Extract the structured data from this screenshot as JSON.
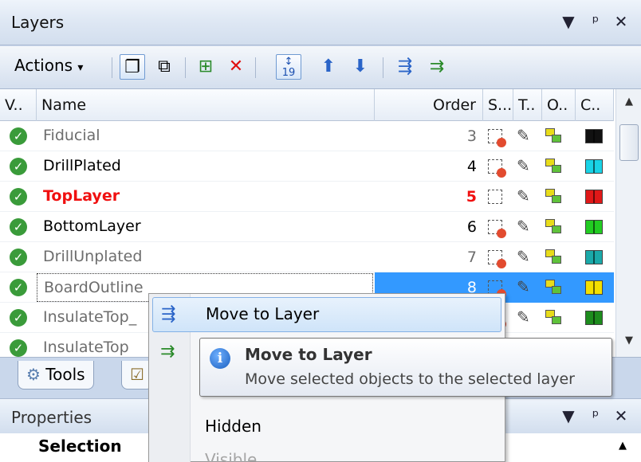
{
  "layers_panel": {
    "title": "Layers",
    "title_buttons": [
      "▾",
      "ᵖ",
      "✕"
    ],
    "actions_label": "Actions",
    "actions_arrow": "▾",
    "toolbar_icons": [
      "copy-layer-icon",
      "paste-layer-icon",
      "add-layer-icon",
      "delete-icon",
      "sort-order-icon",
      "move-up-icon",
      "move-down-icon",
      "move-to-layer-icon",
      "copy-to-layer-icon"
    ],
    "columns": [
      "V..",
      "Name",
      "Order",
      "S...",
      "T..",
      "O..",
      "C.."
    ],
    "rows": [
      {
        "name": "Fiducial",
        "order": "3",
        "style": "gray",
        "color": "#111111"
      },
      {
        "name": "DrillPlated",
        "order": "4",
        "style": "normal",
        "color": "#19d3e6"
      },
      {
        "name": "TopLayer",
        "order": "5",
        "style": "active",
        "color": "#e01818"
      },
      {
        "name": "BottomLayer",
        "order": "6",
        "style": "normal",
        "color": "#22cc22"
      },
      {
        "name": "DrillUnplated",
        "order": "7",
        "style": "gray",
        "color": "#1aa9a9"
      },
      {
        "name": "BoardOutline",
        "order": "8",
        "style": "gray",
        "color": "#f3e000"
      },
      {
        "name": "InsulateTop_",
        "order": "",
        "style": "gray",
        "color": "#1d8c1d"
      },
      {
        "name": "InsulateTop",
        "order": "",
        "style": "gray",
        "color": "#333333"
      }
    ],
    "tabs": [
      "Tools",
      ""
    ]
  },
  "properties_panel": {
    "title": "Properties",
    "selection_label": "Selection"
  },
  "context_menu": {
    "items": [
      {
        "label": "Move to Layer",
        "icon": "move-to-layer-icon",
        "state": "hover"
      },
      {
        "label": "",
        "icon": "copy-to-layer-icon",
        "state": "normal"
      },
      {
        "label": "Hidden",
        "icon": "",
        "state": "normal"
      },
      {
        "label": "Visible",
        "icon": "",
        "state": "disabled"
      }
    ]
  },
  "tooltip": {
    "title": "Move to Layer",
    "description": "Move selected objects to the selected layer"
  }
}
